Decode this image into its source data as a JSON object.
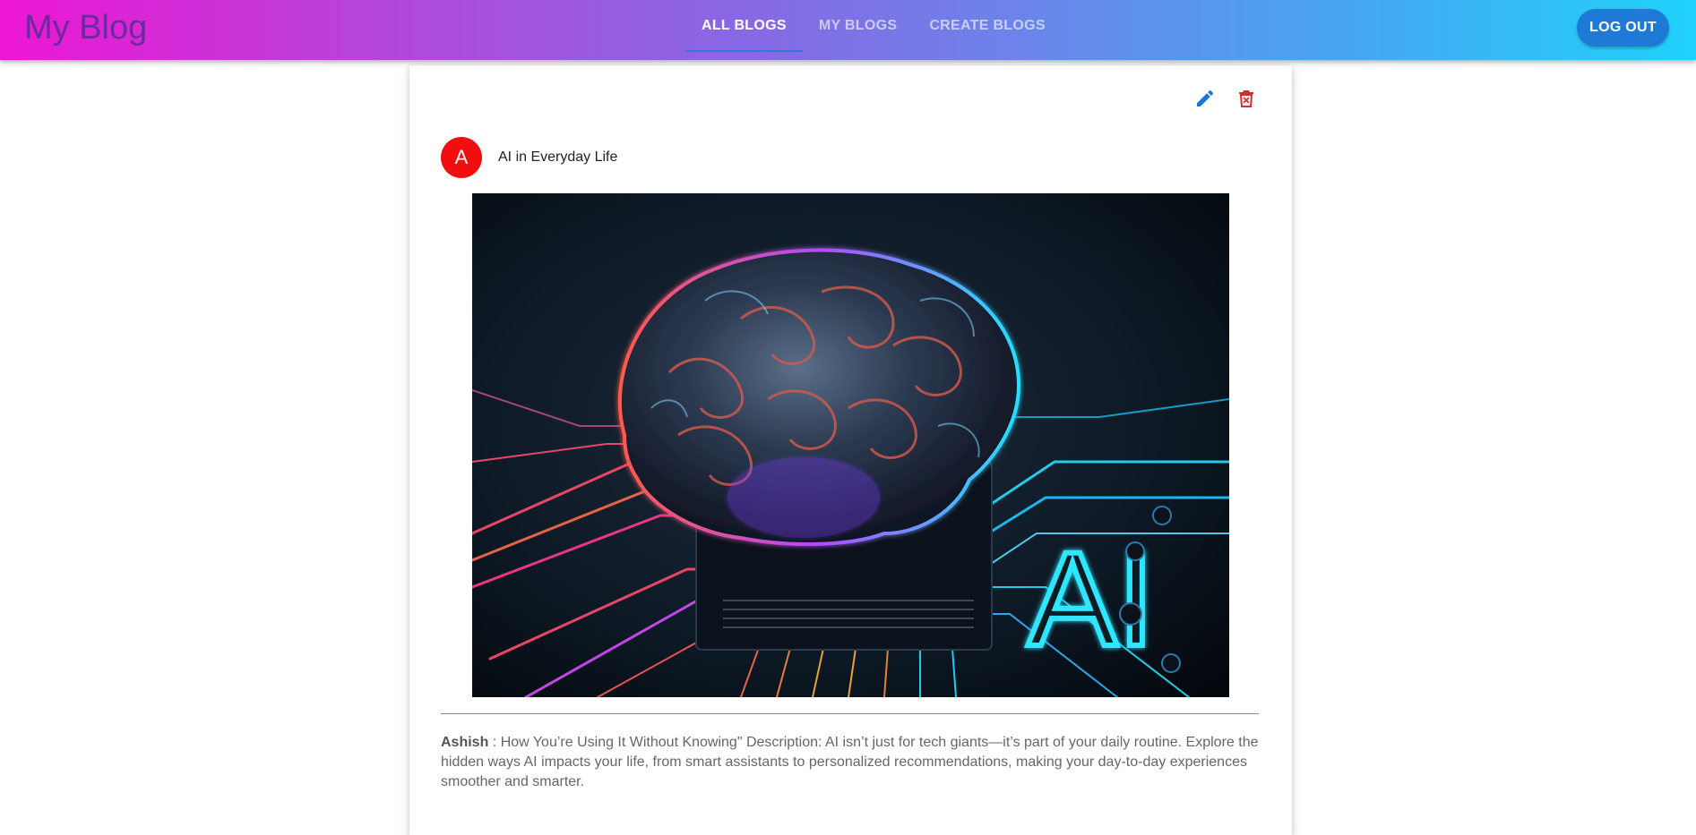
{
  "header": {
    "brand": "My Blog",
    "tabs": [
      {
        "label": "ALL BLOGS",
        "active": true
      },
      {
        "label": "MY BLOGS",
        "active": false
      },
      {
        "label": "CREATE BLOGS",
        "active": false
      }
    ],
    "logout_label": "LOG OUT"
  },
  "blog": {
    "avatar_letter": "A",
    "title": "AI in Everyday Life",
    "image_text": "AI",
    "author": "Ashish",
    "separator": " : ",
    "description": "How You’re Using It Without Knowing\" Description: AI isn’t just for tech giants—it’s part of your daily routine. Explore the hidden ways AI impacts your life, from smart assistants to personalized recommendations, making your day-to-day experiences smoother and smarter.",
    "actions": [
      {
        "icon": "edit-icon",
        "color": "#1976d2"
      },
      {
        "icon": "delete-icon",
        "color": "#d32f2f"
      }
    ]
  },
  "colors": {
    "avatar": "#f20e0e",
    "logout_button": "#1e7ad6",
    "active_tab_indicator": "#2c79d6",
    "brand_text": "#6b2a9e"
  }
}
